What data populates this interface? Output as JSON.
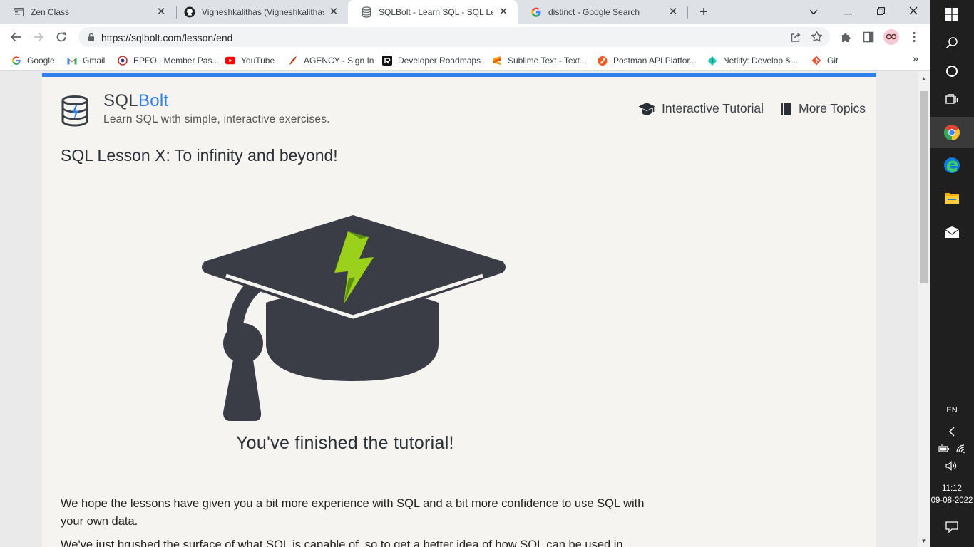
{
  "tabs": [
    {
      "title": "Zen Class",
      "favicon": "window-icon"
    },
    {
      "title": "Vigneshkalithas (Vigneshkalithas)",
      "favicon": "github-icon"
    },
    {
      "title": "SQLBolt - Learn SQL - SQL Lesson",
      "favicon": "sqlbolt-icon",
      "active": true
    },
    {
      "title": "distinct - Google Search",
      "favicon": "google-icon"
    }
  ],
  "address_bar": {
    "url": "https://sqlbolt.com/lesson/end"
  },
  "bookmarks": [
    {
      "label": "Google",
      "icon": "google-icon"
    },
    {
      "label": "Gmail",
      "icon": "gmail-icon"
    },
    {
      "label": "EPFO | Member Pas...",
      "icon": "epfo-icon"
    },
    {
      "label": "YouTube",
      "icon": "youtube-icon"
    },
    {
      "label": "AGENCY - Sign In",
      "icon": "agency-icon"
    },
    {
      "label": "Developer Roadmaps",
      "icon": "roadmap-icon"
    },
    {
      "label": "Sublime Text - Text...",
      "icon": "sublime-icon"
    },
    {
      "label": "Postman API Platfor...",
      "icon": "postman-icon"
    },
    {
      "label": "Netlify: Develop &...",
      "icon": "netlify-icon"
    },
    {
      "label": "Git",
      "icon": "git-icon"
    }
  ],
  "site": {
    "name_part1": "SQL",
    "name_part2": "Bolt",
    "tagline": "Learn SQL with simple, interactive exercises.",
    "nav": {
      "tutorial": "Interactive Tutorial",
      "topics": "More Topics"
    },
    "accent_color": "#2f80ed"
  },
  "lesson": {
    "title": "SQL Lesson X: To infinity and beyond!",
    "finished": "You've finished the tutorial!",
    "paragraphs": [
      "We hope the lessons have given you a bit more experience with SQL and a bit more confidence to use SQL with your own data.",
      "We've just brushed the surface of what SQL is capable of, so to get a better idea of how SQL can be used in"
    ]
  },
  "taskbar": {
    "language": "EN",
    "time": "11:12",
    "date": "09-08-2022"
  }
}
